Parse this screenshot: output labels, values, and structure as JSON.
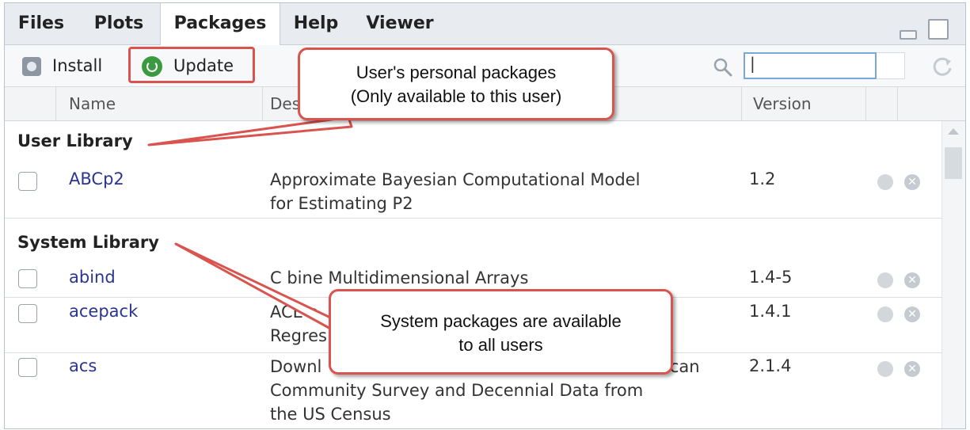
{
  "tabs": [
    "Files",
    "Plots",
    "Packages",
    "Help",
    "Viewer"
  ],
  "active_tab": "Packages",
  "toolbar": {
    "install_label": "Install",
    "update_label": "Update",
    "search_value": "|"
  },
  "columns": {
    "name": "Name",
    "description": "Des",
    "version": "Version"
  },
  "user_library": {
    "title": "User Library",
    "packages": [
      {
        "name": "ABCp2",
        "description_line1": "Approximate Bayesian Computational Model",
        "description_line2": "for Estimating P2",
        "version": "1.2"
      }
    ]
  },
  "system_library": {
    "title": "System Library",
    "packages": [
      {
        "name": "abind",
        "description_line1": "C   bine Multidimensional Arrays",
        "description_line2": "",
        "version": "1.4-5"
      },
      {
        "name": "acepack",
        "description_line1": "ACE a",
        "description_line2": "Regres",
        "version": "1.4.1"
      },
      {
        "name": "acs",
        "description_line1": "Downl",
        "description_line1_end": "ican",
        "description_line2": "Community Survey and Decennial Data from",
        "description_line3": "the US Census",
        "version": "2.1.4"
      }
    ]
  },
  "callouts": {
    "personal": {
      "line1": "User's personal packages",
      "line2": "(Only available to this user)"
    },
    "system": {
      "line1": "System packages are available",
      "line2": "to all users"
    }
  },
  "colors": {
    "callout_border": "#d9534f",
    "package_link": "#2a3592",
    "update_icon": "#3a9a3f"
  }
}
